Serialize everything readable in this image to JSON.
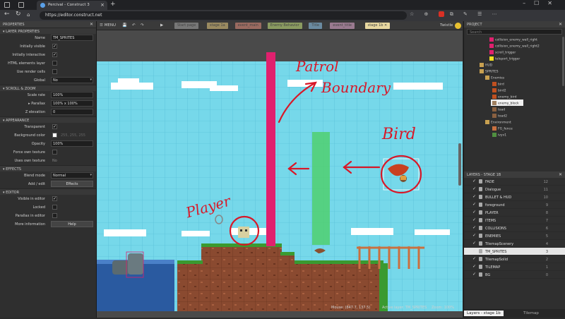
{
  "browser": {
    "tab_title": "Percival - Construct 3",
    "url": "https://editor.construct.net"
  },
  "left_panel": {
    "title": "PROPERTIES",
    "sections": {
      "layer_properties": "LAYER PROPERTIES",
      "scroll_zoom": "SCROLL & ZOOM",
      "appearance": "APPEARANCE",
      "effects": "EFFECTS",
      "editor": "EDITOR"
    },
    "rows": {
      "name_label": "Name",
      "name_value": "TM_SPRITES",
      "initially_visible": "Initially visible",
      "initially_interactive": "Initially interactive",
      "html_layer": "HTML elements layer",
      "render_cells": "Use render cells",
      "global_label": "Global",
      "global_value": "No",
      "scale_rate_label": "Scale rate",
      "scale_rate_value": "100%",
      "parallax_label": "Parallax",
      "parallax_value": "100% x 100%",
      "z_elev_label": "Z elevation",
      "z_elev_value": "0",
      "transparent": "Transparent",
      "bg_color_label": "Background color",
      "bg_color_value": "255, 255, 255",
      "opacity_label": "Opacity",
      "opacity_value": "100%",
      "force_texture": "Force own texture",
      "uses_texture_label": "Uses own texture",
      "uses_texture_value": "No",
      "blend_label": "Blend mode",
      "blend_value": "Normal",
      "add_edit_label": "Add / edit",
      "add_edit_value": "Effects",
      "visible_editor": "Visible in editor",
      "locked": "Locked",
      "parallax_editor": "Parallax in editor",
      "more_info_label": "More information",
      "more_info_value": "Help"
    }
  },
  "toolbar": {
    "menu": "MENU",
    "tabs": [
      "Start page",
      "stage 1a",
      "event_main",
      "Enemy Behavior",
      "Title",
      "event_title",
      "stage 1b"
    ],
    "active_tab": "stage 1b",
    "user": "Twistle"
  },
  "canvas": {
    "annotations": {
      "patrol": "Patrol",
      "boundary": "Boundary",
      "bird": "Bird",
      "player": "Player"
    },
    "status": {
      "mouse": "Mouse: (847.7, 137.5)",
      "active_layer": "Active layer: TM_SPRITES",
      "zoom": "Zoom: 100%"
    }
  },
  "project_panel": {
    "title": "PROJECT",
    "search_placeholder": "Search",
    "items": [
      {
        "label": "collision_enemy_wall_right",
        "color": "#e0206e",
        "indent": 36
      },
      {
        "label": "collision_enemy_wall_right2",
        "color": "#e0206e",
        "indent": 36
      },
      {
        "label": "scroll_trigger",
        "color": "#e0206e",
        "indent": 36
      },
      {
        "label": "teleport_trigger",
        "color": "#f0e020",
        "indent": 36
      },
      {
        "label": "HUD",
        "color": "#c8a050",
        "indent": 22,
        "folder": true
      },
      {
        "label": "SPRITES",
        "color": "#c8a050",
        "indent": 22,
        "folder": true
      },
      {
        "label": "Enemies",
        "color": "#c8a050",
        "indent": 30,
        "folder": true
      },
      {
        "label": "bird",
        "color": "#c05020",
        "indent": 40
      },
      {
        "label": "bird2",
        "color": "#c05020",
        "indent": 40
      },
      {
        "label": "enemy_bird",
        "color": "#c05020",
        "indent": 40
      },
      {
        "label": "enemy_block",
        "color": "#a08060",
        "indent": 40,
        "selected": true
      },
      {
        "label": "toad",
        "color": "#8a6040",
        "indent": 40
      },
      {
        "label": "toad2",
        "color": "#8a6040",
        "indent": 40
      },
      {
        "label": "Environment",
        "color": "#c8a050",
        "indent": 30,
        "folder": true
      },
      {
        "label": "FG_fence",
        "color": "#c87040",
        "indent": 40
      },
      {
        "label": "ivyv1",
        "color": "#509040",
        "indent": 40
      }
    ]
  },
  "layers_panel": {
    "title": "LAYERS - STAGE 1B",
    "layers": [
      {
        "name": "FADE",
        "num": "12"
      },
      {
        "name": "Dialogue",
        "num": "11"
      },
      {
        "name": "BULLET & HUD",
        "num": "10"
      },
      {
        "name": "foreground",
        "num": "9"
      },
      {
        "name": "PLAYER",
        "num": "8"
      },
      {
        "name": "ITEMS",
        "num": "7"
      },
      {
        "name": "COLLISIONS",
        "num": "6"
      },
      {
        "name": "ENEMIES",
        "num": "5"
      },
      {
        "name": "TilemapScenery",
        "num": "4"
      },
      {
        "name": "TM_SPRITES",
        "num": "3",
        "selected": true
      },
      {
        "name": "TilemapSolid",
        "num": "2"
      },
      {
        "name": "TILEMAP",
        "num": "1"
      },
      {
        "name": "BG",
        "num": "0"
      }
    ],
    "bottom_tabs": [
      "Layers - stage 1b",
      "Tilemap"
    ]
  }
}
